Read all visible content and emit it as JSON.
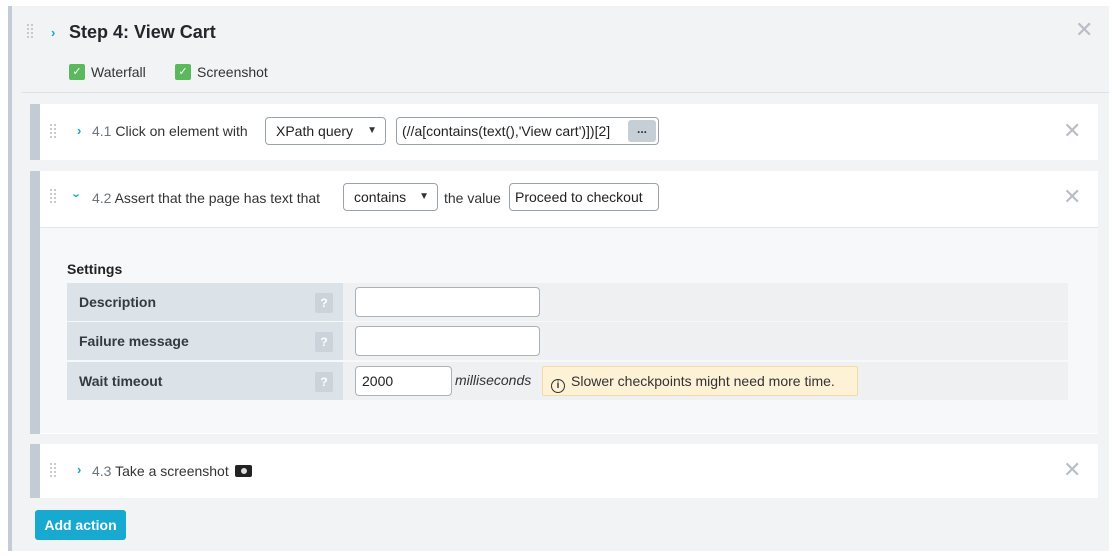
{
  "step": {
    "title": "Step 4: View Cart",
    "options": [
      {
        "label": "Waterfall",
        "checked": true
      },
      {
        "label": "Screenshot",
        "checked": true
      }
    ]
  },
  "actions": [
    {
      "number": "4.1",
      "text": "Click on element with",
      "selector": "XPath query",
      "value": "(//a[contains(text(),'View cart')])[2]",
      "more_label": "..."
    },
    {
      "number": "4.2",
      "text": "Assert that the page has text that",
      "selector": "contains",
      "mid_text": "the value",
      "value": "Proceed to checkout",
      "settings": {
        "heading": "Settings",
        "rows": [
          {
            "label": "Description",
            "value": ""
          },
          {
            "label": "Failure message",
            "value": ""
          },
          {
            "label": "Wait timeout",
            "value": "2000",
            "unit": "milliseconds"
          }
        ],
        "help_label": "?",
        "warning": "Slower checkpoints might need more time.",
        "warning_icon": "i"
      }
    },
    {
      "number": "4.3",
      "text": "Take a screenshot"
    }
  ],
  "add_action_label": "Add action",
  "colors": {
    "accent": "#17a9cf",
    "checkbox": "#5cb85c",
    "warning_bg": "#fdf1d6"
  }
}
